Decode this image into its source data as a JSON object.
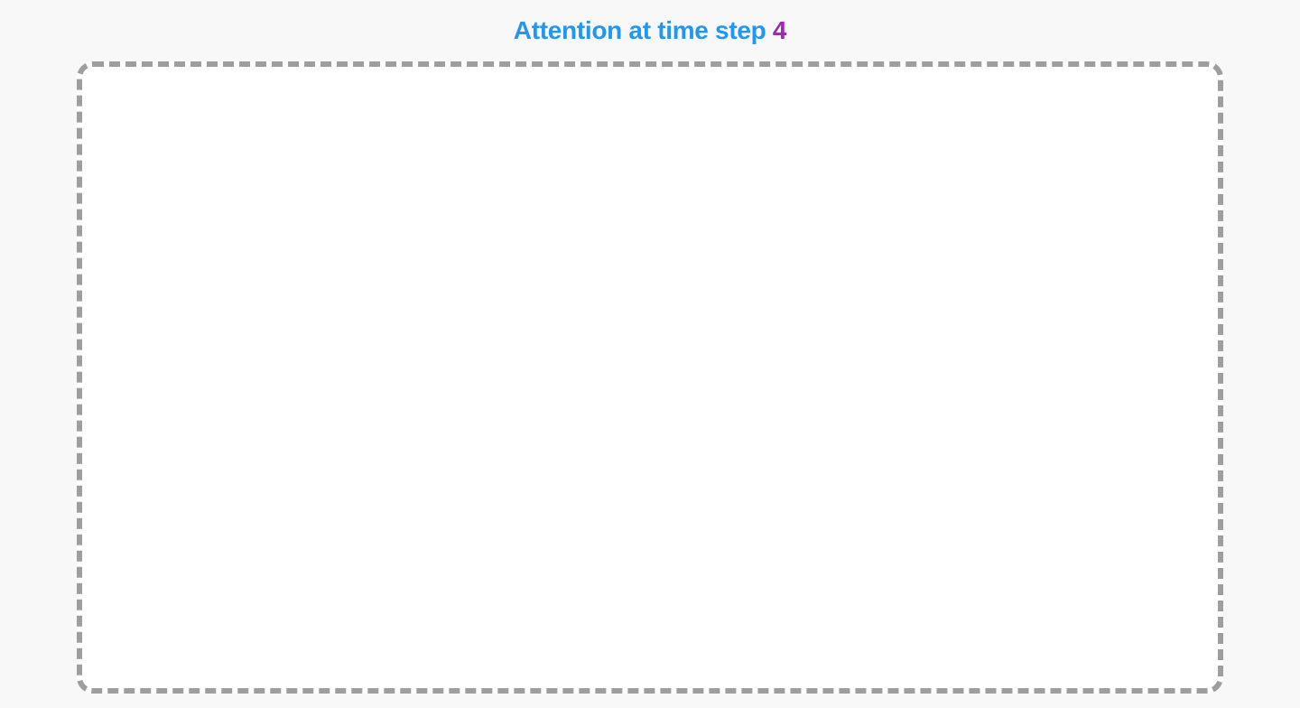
{
  "title": {
    "main": "Attention at time step ",
    "step": "4"
  },
  "colors": {
    "title_main": "#2196F3",
    "title_step": "#9C27B0",
    "dash_border": "#9e9e9e",
    "background": "#f8f8f8",
    "box_background": "#ffffff"
  }
}
